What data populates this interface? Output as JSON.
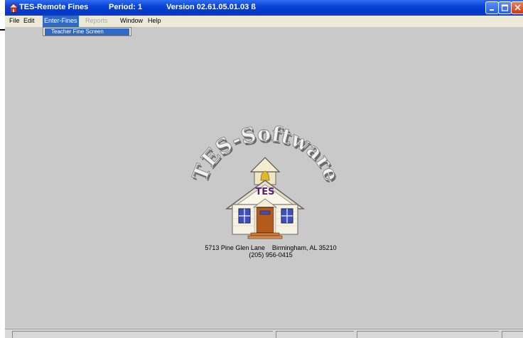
{
  "window": {
    "app_name": "TES-Remote Fines",
    "period": "Period: 1",
    "version": "Version 02.61.05.01.03 ß"
  },
  "menubar": {
    "items": [
      {
        "label": "File"
      },
      {
        "label": "Edit"
      },
      {
        "label": "Enter-Fines"
      },
      {
        "label": "Reports"
      },
      {
        "label": "Window"
      },
      {
        "label": "Help"
      }
    ]
  },
  "dropdown": {
    "items": [
      {
        "label": "Teacher Fine Screen"
      }
    ]
  },
  "logo": {
    "arc_text": "TES-Software",
    "door_text": "TES"
  },
  "address": {
    "street": "5713 Pine Glen Lane",
    "city": "Birmingham, AL 35210",
    "phone": "(205) 956-0415"
  },
  "colors": {
    "titlebar": "#0a43d6",
    "menu_highlight": "#316ac5",
    "desktop": "#c9c9c9",
    "door_text": "#5b2078"
  }
}
